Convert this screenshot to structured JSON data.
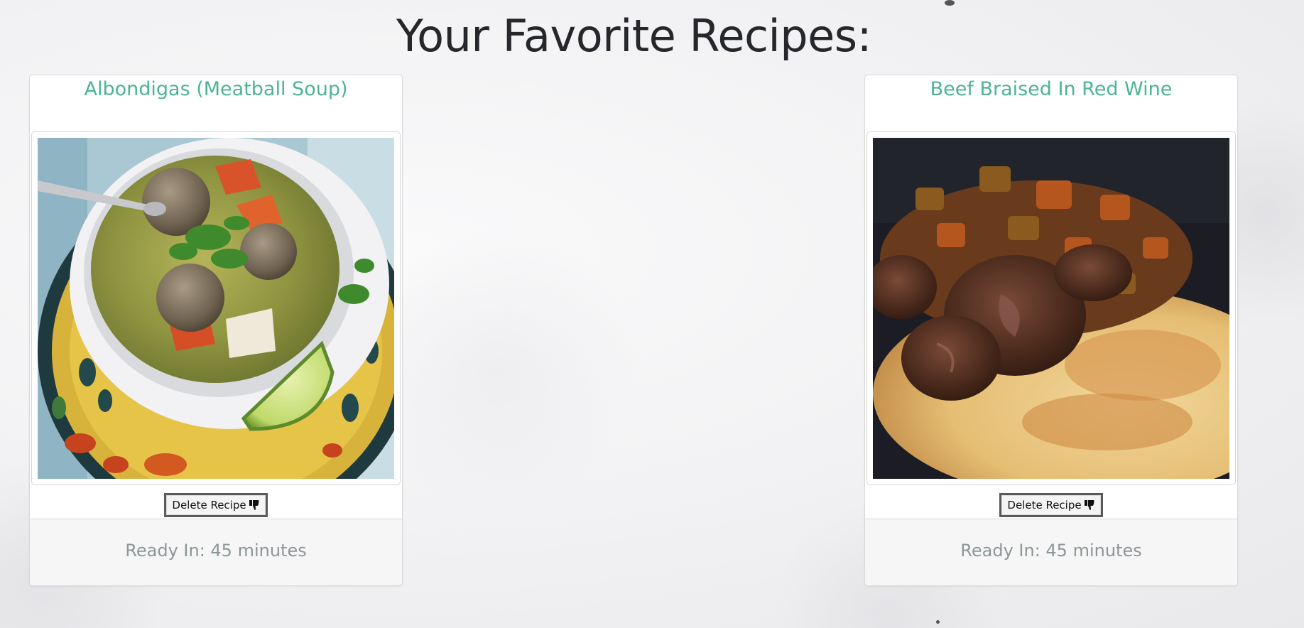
{
  "page": {
    "title": "Your Favorite Recipes:"
  },
  "recipes": [
    {
      "title": "Albondigas (Meatball Soup)",
      "image_alt": "meatball soup in a white bowl with lime",
      "delete_label": "Delete Recipe",
      "delete_icon": "thumbs-down-icon",
      "ready_text": "Ready In: 45 minutes"
    },
    {
      "title": "Beef Braised In Red Wine",
      "image_alt": "braised beef on polenta",
      "delete_label": "Delete Recipe",
      "delete_icon": "thumbs-down-icon",
      "ready_text": "Ready In: 45 minutes"
    }
  ],
  "colors": {
    "title_accent": "#4cb493",
    "muted_text": "#8d9698",
    "heading": "#25272b"
  }
}
